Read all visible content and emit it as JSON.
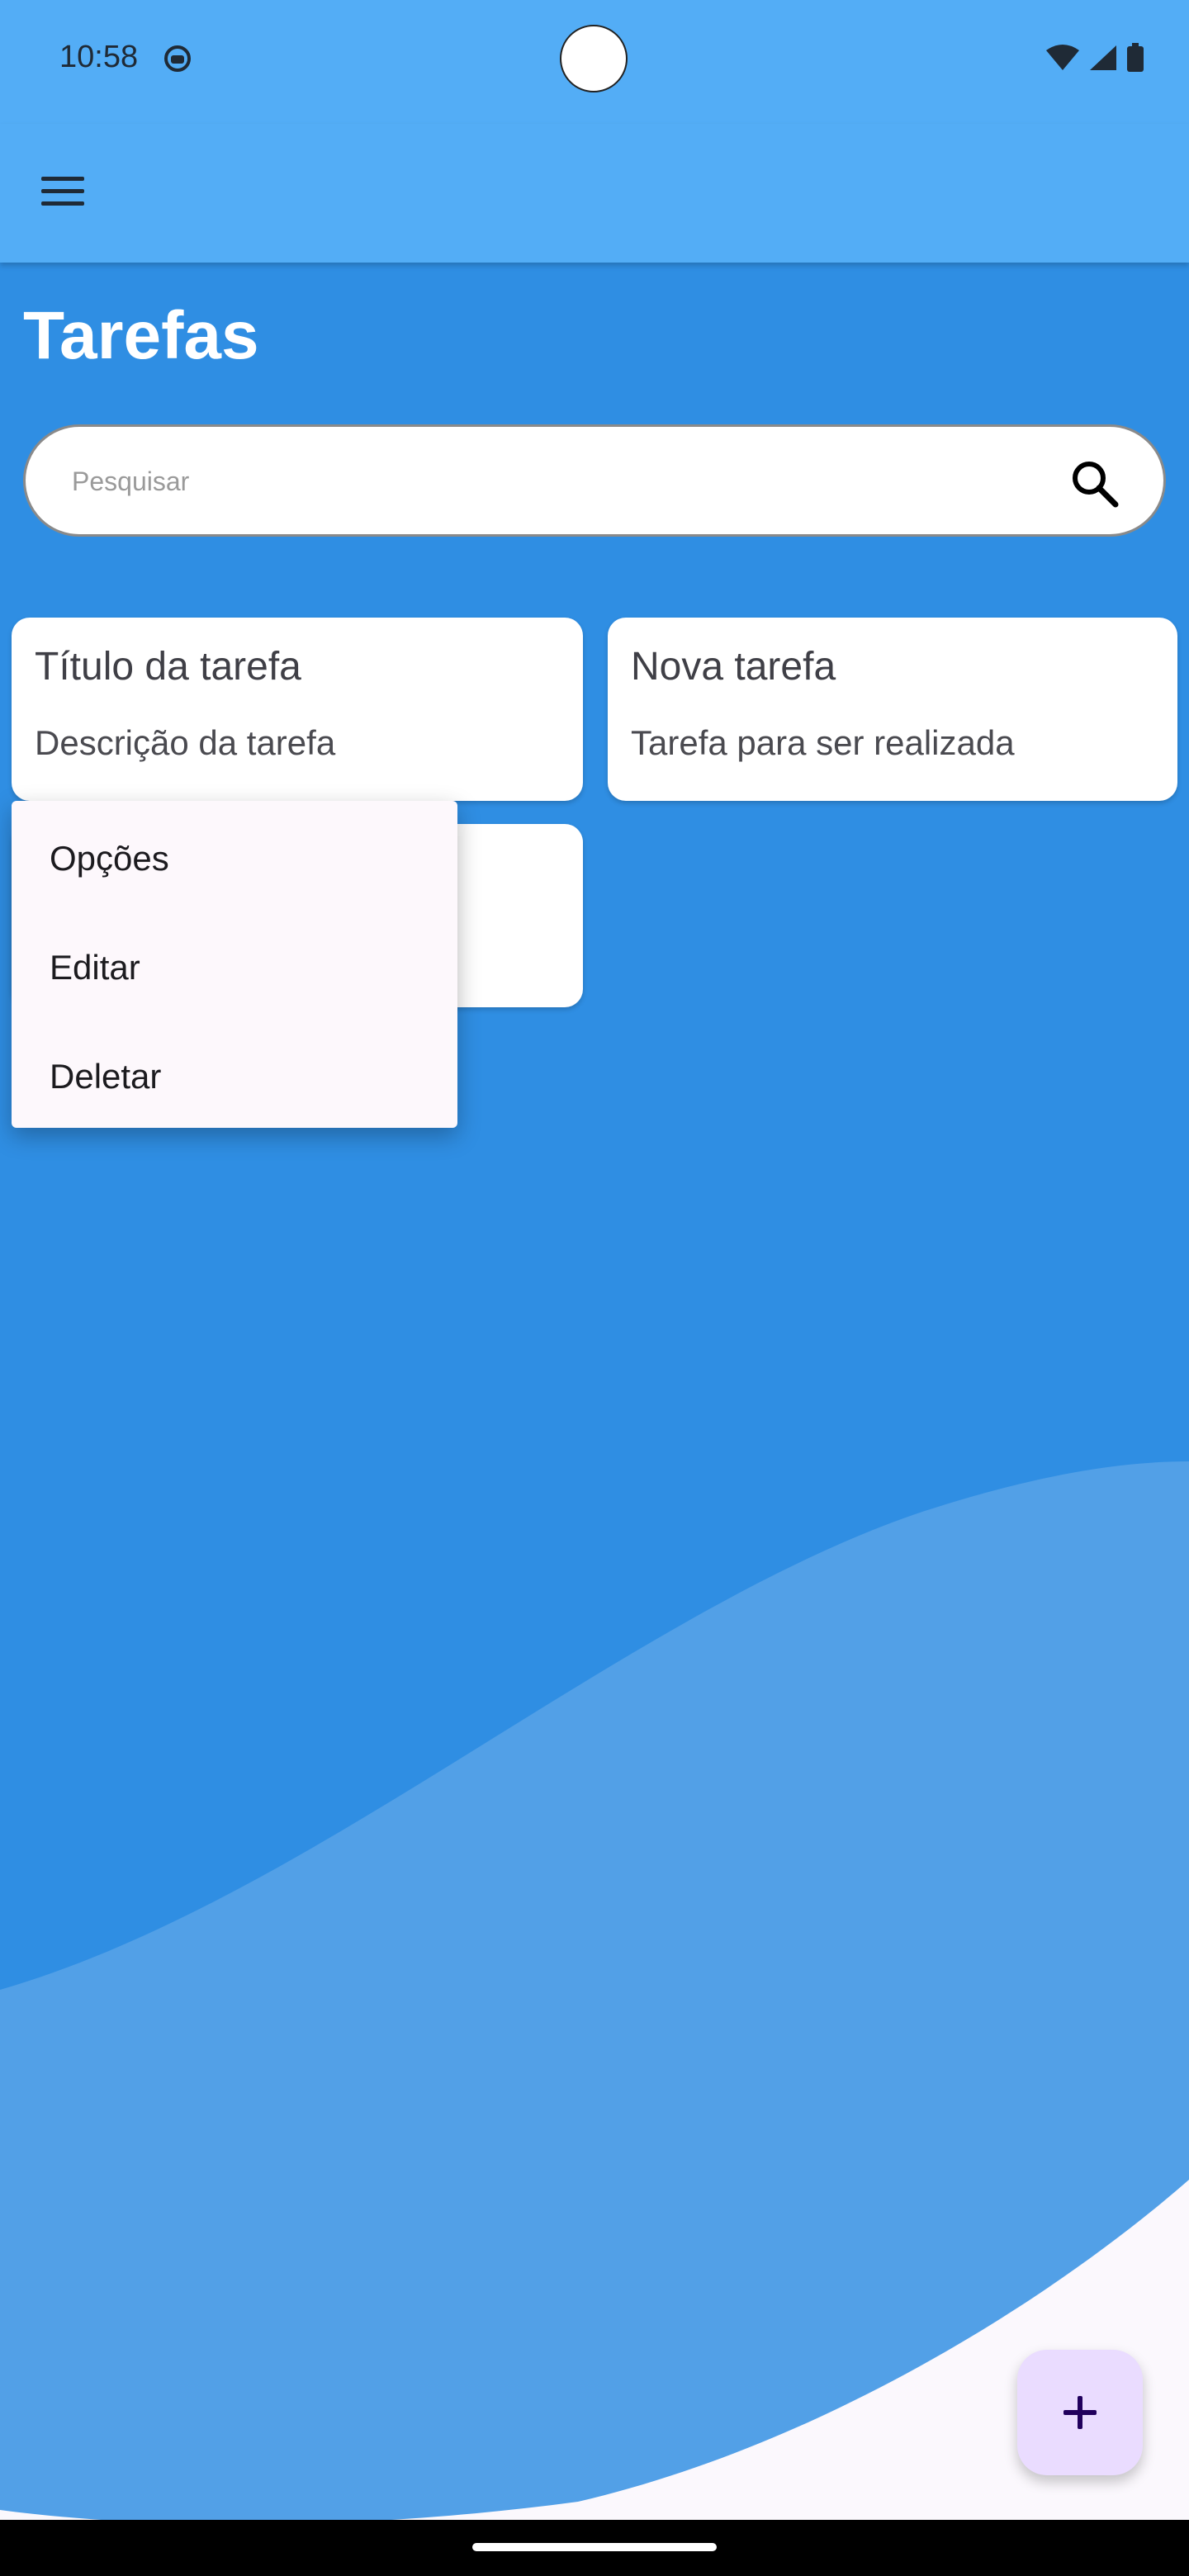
{
  "status_bar": {
    "time": "10:58",
    "icons": [
      "face-notification-icon",
      "wifi-icon",
      "signal-icon",
      "battery-icon"
    ]
  },
  "app_bar": {
    "menu_icon": "hamburger-menu-icon"
  },
  "page": {
    "title": "Tarefas"
  },
  "search": {
    "placeholder": "Pesquisar",
    "icon": "search-icon"
  },
  "tasks": [
    {
      "title": "Título da tarefa",
      "description": "Descrição da tarefa"
    },
    {
      "title": "Nova tarefa",
      "description": "Tarefa para ser realizada"
    }
  ],
  "context_menu": {
    "items": [
      "Opções",
      "Editar",
      "Deletar"
    ]
  },
  "fab": {
    "icon": "plus-icon"
  },
  "colors": {
    "app_bar": "#53adf6",
    "background": "#2f8ee3",
    "wave_light": "#52a0e7",
    "bottom_surface": "#fbf8fd",
    "fab": "#eadcff",
    "menu_surface": "#fdf8fc"
  }
}
